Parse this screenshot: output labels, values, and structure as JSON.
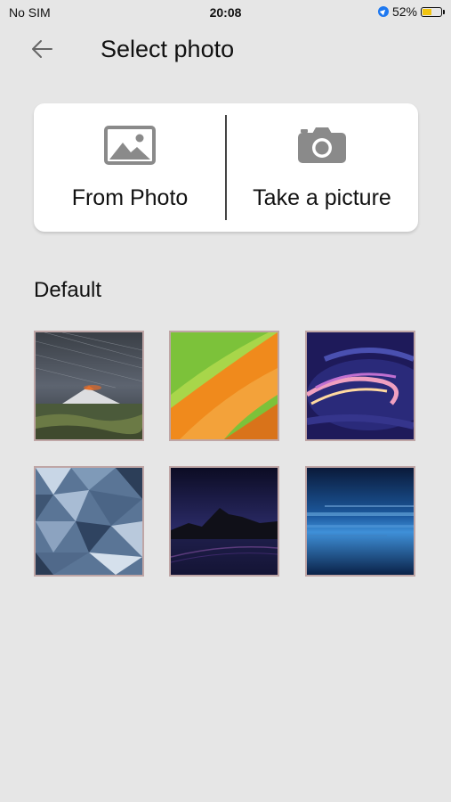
{
  "status_bar": {
    "carrier": "No SIM",
    "time": "20:08",
    "battery_percent_label": "52%",
    "battery_level": 0.52
  },
  "header": {
    "title": "Select photo",
    "back_icon": "arrow-left-icon"
  },
  "sources": [
    {
      "label": "From Photo",
      "icon": "image-icon"
    },
    {
      "label": "Take a picture",
      "icon": "camera-icon"
    }
  ],
  "default_section": {
    "title": "Default"
  },
  "colors": {
    "background": "#e6e6e6",
    "card": "#ffffff",
    "icon_gray": "#8a8a8a",
    "battery_fill": "#f1c40f",
    "location_blue": "#1e78f0"
  }
}
